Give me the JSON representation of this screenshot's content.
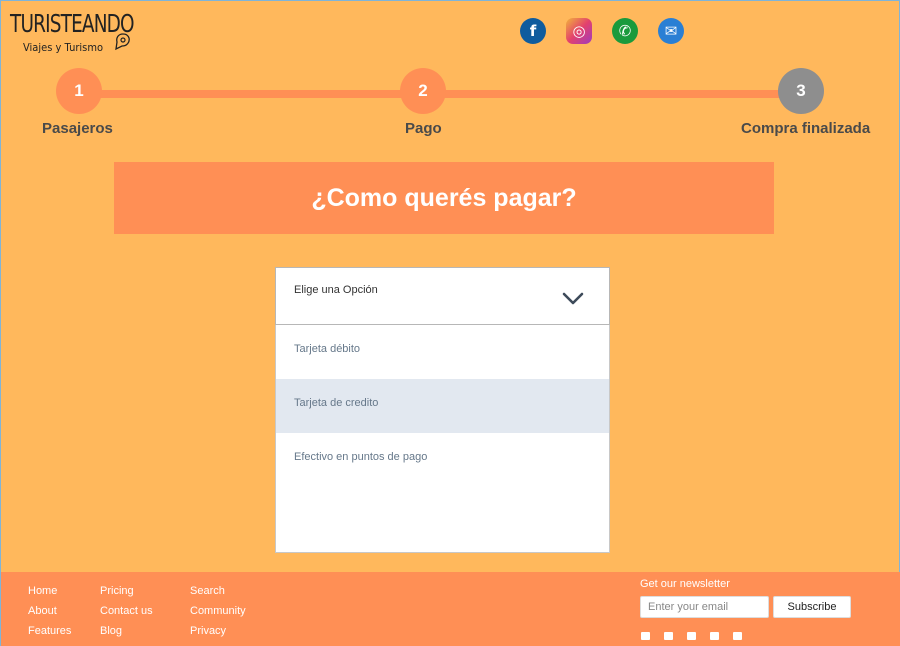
{
  "header": {
    "logo_main": "TURISTEANDO",
    "logo_sub": "Viajes y Turismo",
    "social": [
      {
        "icon": "facebook-icon",
        "glyph": "f"
      },
      {
        "icon": "instagram-icon",
        "glyph": "◎"
      },
      {
        "icon": "whatsapp-icon",
        "glyph": "✆"
      },
      {
        "icon": "mail-icon",
        "glyph": "✉"
      }
    ]
  },
  "stepper": {
    "steps": [
      {
        "number": "1",
        "label": "Pasajeros"
      },
      {
        "number": "2",
        "label": "Pago"
      },
      {
        "number": "3",
        "label": "Compra finalizada"
      }
    ],
    "current_step": 2
  },
  "banner": {
    "title": "¿Como querés pagar?"
  },
  "payment_select": {
    "placeholder": "Elige una Opción",
    "options": [
      "Tarjeta débito",
      "Tarjeta de credito",
      "Efectivo en puntos de pago"
    ],
    "highlighted_index": 1
  },
  "footer": {
    "col1": [
      "Home",
      "About",
      "Features"
    ],
    "col2": [
      "Pricing",
      "Contact us",
      "Blog"
    ],
    "col3": [
      "Search",
      "Community",
      "Privacy"
    ],
    "newsletter_title": "Get our newsletter",
    "email_placeholder": "Enter your email",
    "subscribe_label": "Subscribe",
    "social_icons": [
      "facebook-icon",
      "instagram-icon",
      "snapchat-icon",
      "twitter-icon",
      "youtube-icon"
    ]
  },
  "colors": {
    "background": "#ffb85c",
    "accent": "#ff8f55",
    "step_inactive": "#8e8e8e",
    "option_highlight": "#e2e8f0"
  }
}
